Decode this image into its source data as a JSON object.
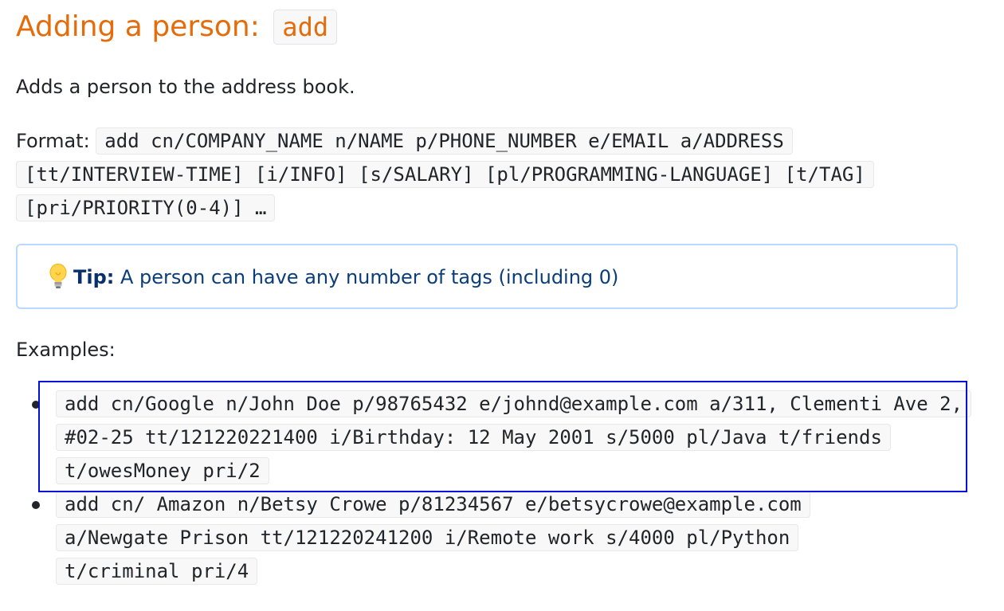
{
  "title": {
    "text": "Adding a person: ",
    "code": "add"
  },
  "intro": "Adds a person to the address book.",
  "format": {
    "label": "Format: ",
    "code": "add cn/COMPANY_NAME n/NAME p/PHONE_NUMBER e/EMAIL a/ADDRESS [tt/INTERVIEW-TIME] [i/INFO] [s/SALARY] [pl/PROGRAMMING-LANGUAGE] [t/TAG] [pri/PRIORITY(0-4)] …"
  },
  "tip": {
    "icon": "lightbulb-icon",
    "label": "Tip:",
    "text": " A person can have any number of tags (including 0)"
  },
  "examples": {
    "heading": "Examples:",
    "items": [
      "add cn/Google n/John Doe p/98765432 e/johnd@example.com a/311, Clementi Ave 2, #02-25 tt/121220221400 i/Birthday: 12 May 2001 s/5000 pl/Java t/friends t/owesMoney pri/2",
      "add cn/ Amazon n/Betsy Crowe p/81234567 e/betsycrowe@example.com a/Newgate Prison tt/121220241200 i/Remote work s/4000 pl/Python t/criminal pri/4"
    ]
  },
  "colors": {
    "heading": "#e46c0a",
    "tip_border": "#b8daff",
    "tip_text": "#0a3d7a",
    "highlight": "#0010d8"
  }
}
